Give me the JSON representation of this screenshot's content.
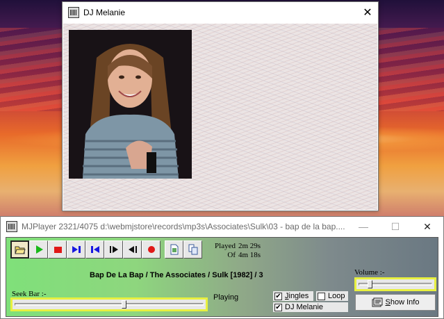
{
  "dj_window": {
    "title": "DJ Melanie",
    "close_glyph": "✕"
  },
  "player_window": {
    "title": "MJPlayer 2321/4075 d:\\webmjstore\\records\\mp3s\\Associates\\Sulk\\03 - bap de la bap....",
    "minimize_glyph": "—",
    "maximize_glyph": "☐",
    "close_glyph": "✕",
    "controls": [
      {
        "name": "open-folder",
        "icon": "folder-open-icon"
      },
      {
        "name": "play",
        "icon": "play-icon"
      },
      {
        "name": "stop",
        "icon": "stop-icon"
      },
      {
        "name": "next-track",
        "icon": "skip-next-icon"
      },
      {
        "name": "previous-track",
        "icon": "skip-previous-icon"
      },
      {
        "name": "fast-forward",
        "icon": "step-forward-icon"
      },
      {
        "name": "rewind",
        "icon": "step-back-icon"
      },
      {
        "name": "record",
        "icon": "record-icon"
      },
      {
        "name": "export",
        "icon": "document-export-icon"
      },
      {
        "name": "copy",
        "icon": "document-copy-icon"
      }
    ],
    "played_label": "Played",
    "played_value": "2m 29s",
    "of_label": "Of",
    "of_value": "4m 18s",
    "track_title": "Bap De La Bap / The Associates / Sulk [1982] / 3",
    "seek_label": "Seek Bar :-",
    "seek_fraction": 0.58,
    "status": "Playing",
    "volume_label": "Volume :-",
    "volume_fraction": 0.15,
    "jingles_label_first": "J",
    "jingles_label_rest": "ingles",
    "jingles_checked": true,
    "loop_label": "Loop",
    "loop_checked": false,
    "dj_label": "DJ Melanie",
    "dj_checked": true,
    "show_info_prefix": "",
    "show_info_first": "S",
    "show_info_rest": "how Info",
    "colors": {
      "play": "#18b818",
      "stop": "#e01818",
      "nav": "#1818e0",
      "record": "#e01818",
      "slider_frame": "#e8f040"
    }
  }
}
